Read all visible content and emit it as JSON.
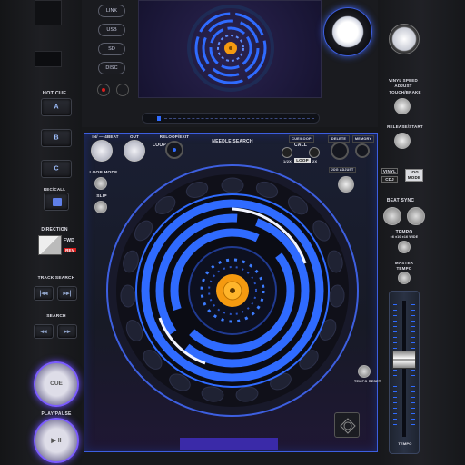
{
  "left_panel": {
    "hot_cue_label": "HOT CUE",
    "hot_cues": [
      "A",
      "B",
      "C"
    ],
    "rec_call_label": "REC/CALL",
    "direction_label": "DIRECTION",
    "fwd_label": "FWD",
    "rev_label": "REV",
    "track_search_label": "TRACK SEARCH",
    "search_label": "SEARCH",
    "cue_label": "CUE",
    "play_pause_label": "PLAY/PAUSE",
    "play_glyph": "▶ II"
  },
  "top": {
    "sources": [
      "LINK",
      "USB",
      "SD",
      "DISC"
    ]
  },
  "deck": {
    "in_label": "IN/ — 4BEAT",
    "out_label": "OUT",
    "reloop_label": "RELOOP/EXIT",
    "loop_label": "LOOP",
    "needle_search_label": "NEEDLE SEARCH",
    "cue_loop_label": "CUE/LOOP",
    "delete_label": "DELETE",
    "memory_label": "MEMORY",
    "call_label": "CALL",
    "loop_1_2": "1/2X",
    "loop_btn": "LOOP",
    "loop_2x": "2X",
    "loop_mode_label": "LOOP MODE",
    "slip_label": "SLIP",
    "jog_adjust_label": "JOG ADJUST",
    "tempo_reset_label": "TEMPO RESET"
  },
  "right_panel": {
    "vinyl_speed_label": "VINYL SPEED ADJUST",
    "touch_brake_label": "TOUCH/BRAKE",
    "release_start_label": "RELEASE/START",
    "vinyl_label": "VINYL",
    "cdj_label": "CDJ",
    "jog_mode_label": "JOG MODE",
    "beat_sync_label": "BEAT SYNC",
    "tempo_label": "TEMPO",
    "tempo_range": "±6 ±10 ±16 WIDE",
    "master_tempo_label": "MASTER TEMPO",
    "fader_label": "TEMPO",
    "tempo_fader_level": 0.42
  },
  "colors": {
    "accent": "#2f6bff",
    "jog_center": "#f59a10",
    "rev_red": "#d81e1e",
    "deck_border": "#3d5fe0"
  }
}
